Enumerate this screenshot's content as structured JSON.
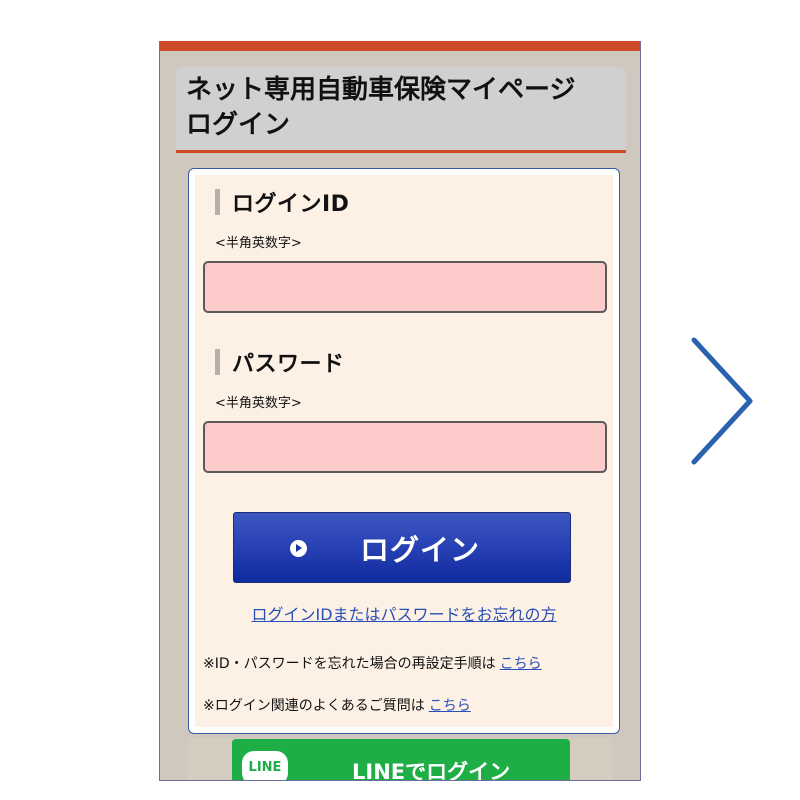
{
  "header": {
    "title_line1": "ネット専用自動車保険マイページ",
    "title_line2": "ログイン"
  },
  "login_id": {
    "label": "ログインID",
    "hint": "<半角英数字>",
    "value": ""
  },
  "password": {
    "label": "パスワード",
    "hint": "<半角英数字>",
    "value": ""
  },
  "login_button": {
    "label": "ログイン"
  },
  "forgot_link": "ログインIDまたはパスワードをお忘れの方",
  "notes": [
    {
      "text": "※ID・パスワードを忘れた場合の再設定手順は",
      "link": "こちら"
    },
    {
      "text": "※ログイン関連のよくあるご質問は",
      "link": "こちら"
    }
  ],
  "line_login": {
    "badge": "LINE",
    "label": "LINEでログイン"
  },
  "colors": {
    "top_bar": "#cf4b28",
    "header_bg": "#d0d0d0",
    "form_bg": "#fdf0e5",
    "field_bg": "#fccac8",
    "login_button": "#1a34a8",
    "link": "#2650b8",
    "line_green": "#1fae46",
    "arrow": "#2a62b0"
  },
  "icons": {
    "login_button_icon": "play-circle-icon",
    "next_arrow": "chevron-right-icon"
  }
}
